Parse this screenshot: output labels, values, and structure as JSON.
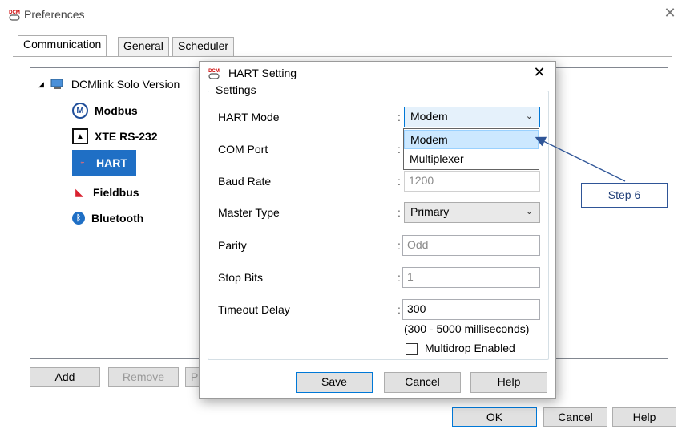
{
  "prefs": {
    "icon_text": "DCM",
    "title": "Preferences",
    "close_glyph": "✕",
    "tabs": [
      {
        "label": "Communication"
      },
      {
        "label": "General"
      },
      {
        "label": "Scheduler"
      }
    ],
    "tree": {
      "root_label": "DCMlink Solo Version",
      "items": [
        {
          "label": "Modbus",
          "icon": "modbus-icon"
        },
        {
          "label": "XTE RS-232",
          "icon": "rs232-icon"
        },
        {
          "label": "HART",
          "icon": "hart-icon",
          "selected": true
        },
        {
          "label": "Fieldbus",
          "icon": "fieldbus-icon"
        },
        {
          "label": "Bluetooth",
          "icon": "bluetooth-icon"
        }
      ]
    },
    "buttons": {
      "add": "Add",
      "remove": "Remove",
      "properties_partial": "P"
    },
    "footer": {
      "ok": "OK",
      "cancel": "Cancel",
      "help": "Help"
    }
  },
  "dialog": {
    "icon_text": "DCM",
    "title": "HART Setting",
    "close_glyph": "✕",
    "group_title": "Settings",
    "fields": {
      "hart_mode": {
        "label": "HART Mode",
        "value": "Modem"
      },
      "com_port": {
        "label": "COM Port"
      },
      "baud_rate": {
        "label": "Baud Rate",
        "value": "1200"
      },
      "master_type": {
        "label": "Master Type",
        "value": "Primary"
      },
      "parity": {
        "label": "Parity",
        "value": "Odd"
      },
      "stop_bits": {
        "label": "Stop Bits",
        "value": "1"
      },
      "timeout_delay": {
        "label": "Timeout Delay",
        "value": "300",
        "hint": "(300 - 5000 milliseconds)"
      }
    },
    "colon": ":",
    "multidrop_label": "Multidrop Enabled",
    "multidrop_checked": false,
    "dropdown_options": [
      "Modem",
      "Multiplexer"
    ],
    "dropdown_selected": "Modem",
    "buttons": {
      "save": "Save",
      "cancel": "Cancel",
      "help": "Help"
    }
  },
  "annotation": {
    "label": "Step 6",
    "color": "#2f5597"
  },
  "colors": {
    "selection": "#0078d7",
    "highlight": "#cce8ff",
    "bluetooth": "#1f6fc5",
    "hart_logo": "#d9212f"
  }
}
